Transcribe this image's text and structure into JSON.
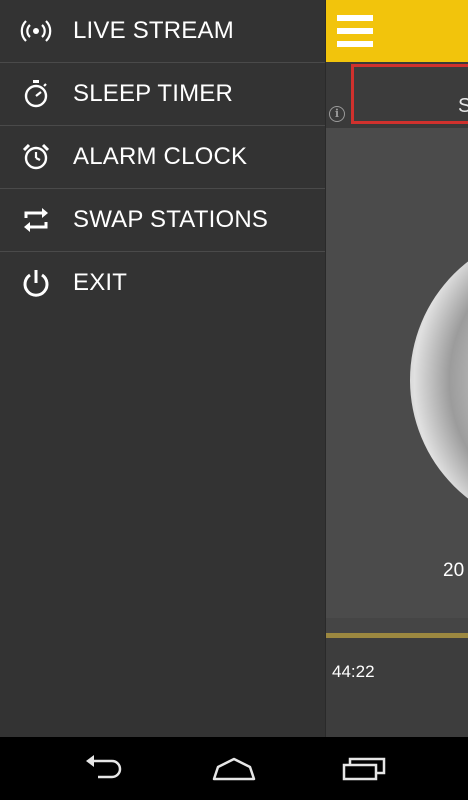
{
  "drawer": {
    "items": [
      {
        "label": "LIVE STREAM",
        "icon": "broadcast-icon"
      },
      {
        "label": "SLEEP TIMER",
        "icon": "stopwatch-icon"
      },
      {
        "label": "ALARM CLOCK",
        "icon": "alarm-clock-icon"
      },
      {
        "label": "SWAP STATIONS",
        "icon": "swap-icon"
      },
      {
        "label": "EXIT",
        "icon": "power-icon"
      }
    ]
  },
  "app": {
    "ad_text": "S",
    "disc_label": "20",
    "elapsed_time": "44:22"
  },
  "colors": {
    "app_bar": "#f2c40c",
    "drawer_bg": "#333333",
    "ad_border": "#d0312d",
    "progress": "#9c8840"
  },
  "nav_bar": {
    "buttons": [
      "back-icon",
      "home-icon",
      "recent-apps-icon"
    ]
  }
}
